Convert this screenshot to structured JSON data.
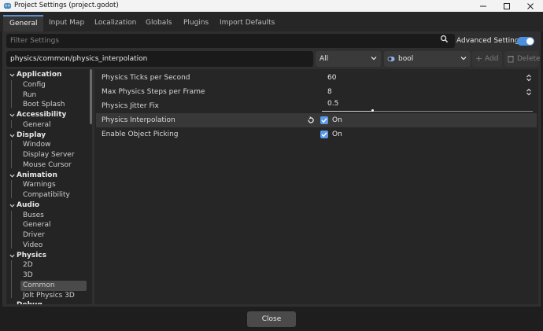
{
  "window": {
    "title": "Project Settings (project.godot)",
    "minimize_icon": "minimize-icon",
    "maximize_icon": "maximize-icon",
    "close_icon": "close-icon"
  },
  "tabs": [
    {
      "label": "General",
      "active": true
    },
    {
      "label": "Input Map"
    },
    {
      "label": "Localization"
    },
    {
      "label": "Globals"
    },
    {
      "label": "Plugins"
    },
    {
      "label": "Import Defaults"
    }
  ],
  "toolbar": {
    "filter_placeholder": "Filter Settings",
    "filter_icon": "filter-icon",
    "advanced_label": "Advanced Settings",
    "advanced_enabled": true,
    "path_value": "physics/common/physics_interpolation",
    "scope_value": "All",
    "type_value": "bool",
    "add_label": "Add",
    "delete_label": "Delete",
    "accent": "#4a8fe0"
  },
  "tree": [
    {
      "label": "Application",
      "kind": "section"
    },
    {
      "label": "Config",
      "kind": "child"
    },
    {
      "label": "Run",
      "kind": "child"
    },
    {
      "label": "Boot Splash",
      "kind": "child"
    },
    {
      "label": "Accessibility",
      "kind": "section"
    },
    {
      "label": "General",
      "kind": "child"
    },
    {
      "label": "Display",
      "kind": "section"
    },
    {
      "label": "Window",
      "kind": "child"
    },
    {
      "label": "Display Server",
      "kind": "child"
    },
    {
      "label": "Mouse Cursor",
      "kind": "child"
    },
    {
      "label": "Animation",
      "kind": "section"
    },
    {
      "label": "Warnings",
      "kind": "child"
    },
    {
      "label": "Compatibility",
      "kind": "child"
    },
    {
      "label": "Audio",
      "kind": "section"
    },
    {
      "label": "Buses",
      "kind": "child"
    },
    {
      "label": "General",
      "kind": "child"
    },
    {
      "label": "Driver",
      "kind": "child"
    },
    {
      "label": "Video",
      "kind": "child"
    },
    {
      "label": "Physics",
      "kind": "section"
    },
    {
      "label": "2D",
      "kind": "child"
    },
    {
      "label": "3D",
      "kind": "child"
    },
    {
      "label": "Common",
      "kind": "child",
      "selected": true
    },
    {
      "label": "Jolt Physics 3D",
      "kind": "child"
    },
    {
      "label": "Debug",
      "kind": "section"
    }
  ],
  "properties": {
    "ticks": {
      "label": "Physics Ticks per Second",
      "value": "60"
    },
    "max_steps": {
      "label": "Max Physics Steps per Frame",
      "value": "8"
    },
    "jitter": {
      "label": "Physics Jitter Fix",
      "value": "0.5"
    },
    "interpolation": {
      "label": "Physics Interpolation",
      "value": "On",
      "checked": true
    },
    "picking": {
      "label": "Enable Object Picking",
      "value": "On",
      "checked": true
    }
  },
  "footer": {
    "close_label": "Close"
  }
}
